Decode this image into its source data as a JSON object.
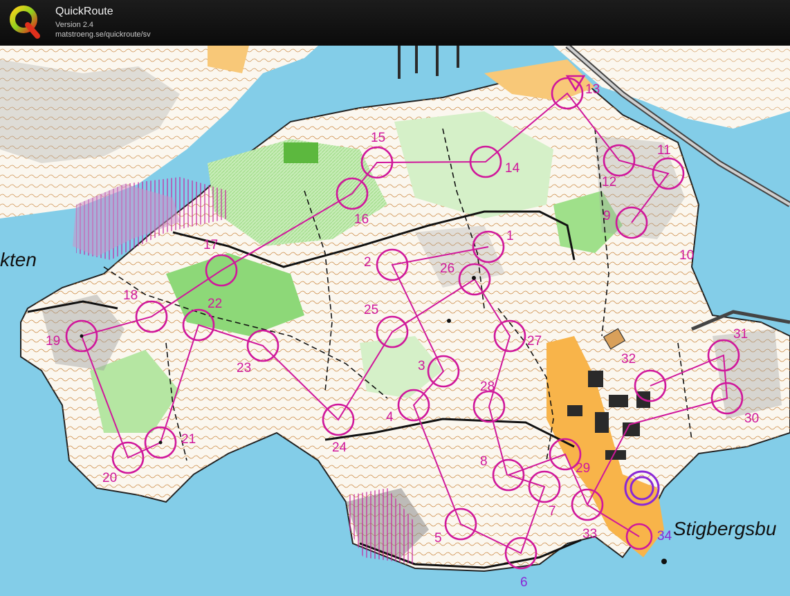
{
  "app": {
    "name": "QuickRoute",
    "version": "Version 2.4",
    "url": "matstroeng.se/quickroute/sv",
    "logo_letter": "Q"
  },
  "map": {
    "place_names": {
      "left": "kten",
      "right": "Stigbergsbu"
    },
    "colors": {
      "water": "#83cde8",
      "land": "#ffffff",
      "course": "#d0179b",
      "finish": "#8a27d6"
    },
    "controls": [
      {
        "label": "1"
      },
      {
        "label": "2"
      },
      {
        "label": "3"
      },
      {
        "label": "4"
      },
      {
        "label": "5"
      },
      {
        "label": "6"
      },
      {
        "label": "7"
      },
      {
        "label": "8"
      },
      {
        "label": "9"
      },
      {
        "label": "10"
      },
      {
        "label": "11"
      },
      {
        "label": "12"
      },
      {
        "label": "13"
      },
      {
        "label": "14"
      },
      {
        "label": "15"
      },
      {
        "label": "16"
      },
      {
        "label": "17"
      },
      {
        "label": "18"
      },
      {
        "label": "19"
      },
      {
        "label": "20"
      },
      {
        "label": "21"
      },
      {
        "label": "22"
      },
      {
        "label": "23"
      },
      {
        "label": "24"
      },
      {
        "label": "25"
      },
      {
        "label": "26"
      },
      {
        "label": "27"
      },
      {
        "label": "28"
      },
      {
        "label": "29"
      },
      {
        "label": "30"
      },
      {
        "label": "31"
      },
      {
        "label": "32"
      },
      {
        "label": "33"
      },
      {
        "label": "34"
      }
    ]
  }
}
